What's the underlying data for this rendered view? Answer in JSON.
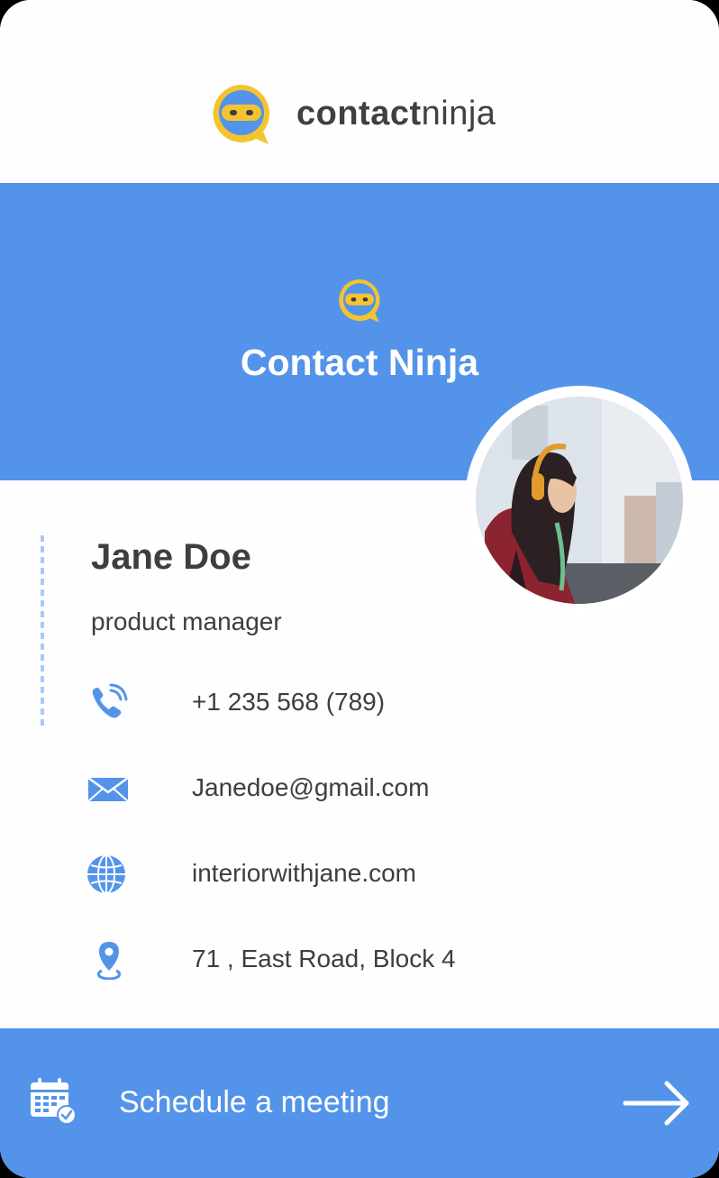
{
  "brand": {
    "name_bold": "contact",
    "name_light": "ninja",
    "logo_icon": "ninja-chat-icon",
    "logo_color": "#f4c430"
  },
  "hero": {
    "title": "Contact Ninja",
    "background": "#5394ea"
  },
  "profile": {
    "avatar": "profile-photo",
    "name": "Jane Doe",
    "role": "product manager"
  },
  "contacts": [
    {
      "icon": "phone-icon",
      "value": "+1 235 568 (789)"
    },
    {
      "icon": "email-icon",
      "value": "Janedoe@gmail.com"
    },
    {
      "icon": "globe-icon",
      "value": "interiorwithjane.com"
    },
    {
      "icon": "location-pin-icon",
      "value": "71 , East Road, Block 4"
    }
  ],
  "cta": {
    "label": "Schedule a meeting",
    "icon": "calendar-check-icon",
    "arrow_icon": "arrow-right-icon"
  }
}
